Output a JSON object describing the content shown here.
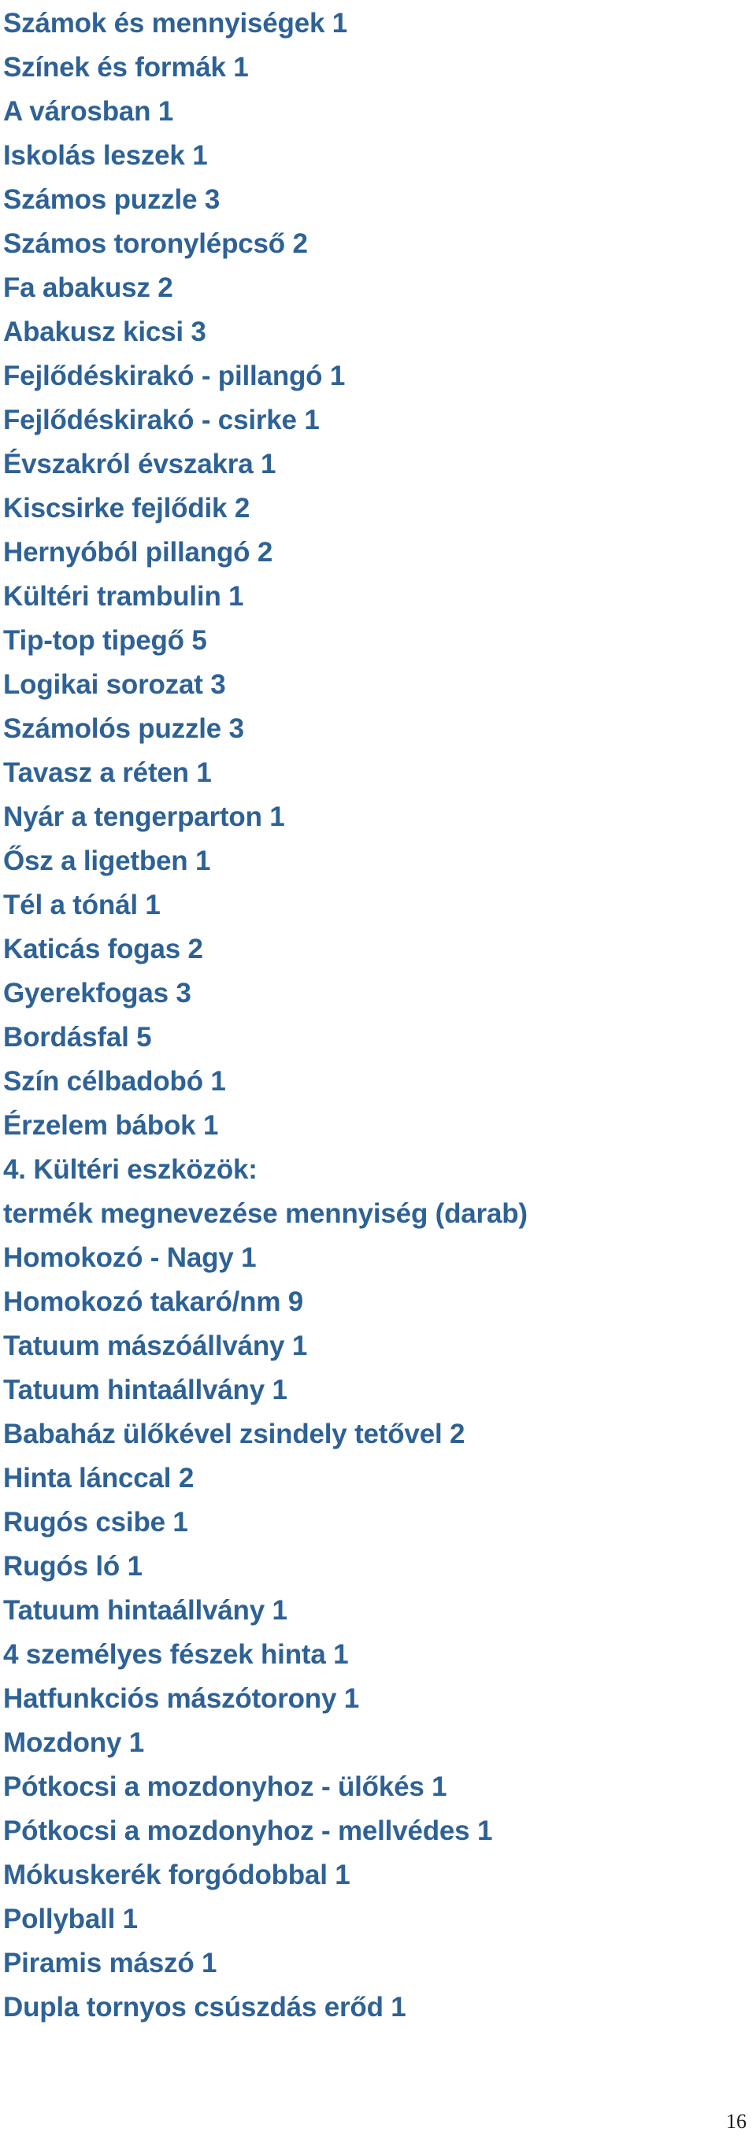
{
  "document": {
    "page_number": "16",
    "text_color": "#2E6296",
    "background_color": "#FFFFFF",
    "page_number_color": "#1A1A1A"
  },
  "lines": [
    {
      "text": "Számok és mennyiségek 1",
      "kind": "item"
    },
    {
      "text": "Színek és formák 1",
      "kind": "item"
    },
    {
      "text": "A városban 1",
      "kind": "item"
    },
    {
      "text": "Iskolás leszek 1",
      "kind": "item"
    },
    {
      "text": "Számos puzzle 3",
      "kind": "item"
    },
    {
      "text": "Számos toronylépcső 2",
      "kind": "item"
    },
    {
      "text": "Fa abakusz 2",
      "kind": "item"
    },
    {
      "text": "Abakusz kicsi 3",
      "kind": "item"
    },
    {
      "text": "Fejlődéskirakó - pillangó 1",
      "kind": "item"
    },
    {
      "text": "Fejlődéskirakó - csirke 1",
      "kind": "item"
    },
    {
      "text": "Évszakról évszakra 1",
      "kind": "item"
    },
    {
      "text": "Kiscsirke fejlődik 2",
      "kind": "item"
    },
    {
      "text": "Hernyóból pillangó 2",
      "kind": "item"
    },
    {
      "text": "Kültéri trambulin 1",
      "kind": "item"
    },
    {
      "text": "Tip-top tipegő 5",
      "kind": "item"
    },
    {
      "text": "Logikai sorozat 3",
      "kind": "item"
    },
    {
      "text": "Számolós puzzle 3",
      "kind": "item"
    },
    {
      "text": "Tavasz a réten 1",
      "kind": "item"
    },
    {
      "text": "Nyár a tengerparton 1",
      "kind": "item"
    },
    {
      "text": "Ősz a ligetben 1",
      "kind": "item"
    },
    {
      "text": "Tél a tónál 1",
      "kind": "item"
    },
    {
      "text": "Katicás fogas 2",
      "kind": "item"
    },
    {
      "text": "Gyerekfogas 3",
      "kind": "item"
    },
    {
      "text": "Bordásfal 5",
      "kind": "item"
    },
    {
      "text": "Szín célbadobó 1",
      "kind": "item"
    },
    {
      "text": "Érzelem bábok 1",
      "kind": "item"
    },
    {
      "text": "4. Kültéri eszközök:",
      "kind": "heading"
    },
    {
      "text": "termék megnevezése mennyiség (darab)",
      "kind": "subheading"
    },
    {
      "text": "Homokozó - Nagy 1",
      "kind": "item"
    },
    {
      "text": "Homokozó takaró/nm 9",
      "kind": "item"
    },
    {
      "text": "Tatuum mászóállvány 1",
      "kind": "item"
    },
    {
      "text": "Tatuum hintaállvány 1",
      "kind": "item"
    },
    {
      "text": "Babaház ülőkével zsindely tetővel 2",
      "kind": "item"
    },
    {
      "text": "Hinta lánccal 2",
      "kind": "item"
    },
    {
      "text": "Rugós csibe 1",
      "kind": "item"
    },
    {
      "text": "Rugós ló 1",
      "kind": "item"
    },
    {
      "text": "Tatuum hintaállvány 1",
      "kind": "item"
    },
    {
      "text": "4 személyes fészek hinta 1",
      "kind": "item"
    },
    {
      "text": "Hatfunkciós mászótorony 1",
      "kind": "item"
    },
    {
      "text": "Mozdony 1",
      "kind": "item"
    },
    {
      "text": "Pótkocsi a mozdonyhoz - ülőkés 1",
      "kind": "item"
    },
    {
      "text": "Pótkocsi a mozdonyhoz - mellvédes 1",
      "kind": "item"
    },
    {
      "text": "Mókuskerék forgódobbal 1",
      "kind": "item"
    },
    {
      "text": "Pollyball 1",
      "kind": "item"
    },
    {
      "text": "Piramis mászó 1",
      "kind": "item"
    },
    {
      "text": "Dupla tornyos csúszdás erőd 1",
      "kind": "item"
    }
  ]
}
